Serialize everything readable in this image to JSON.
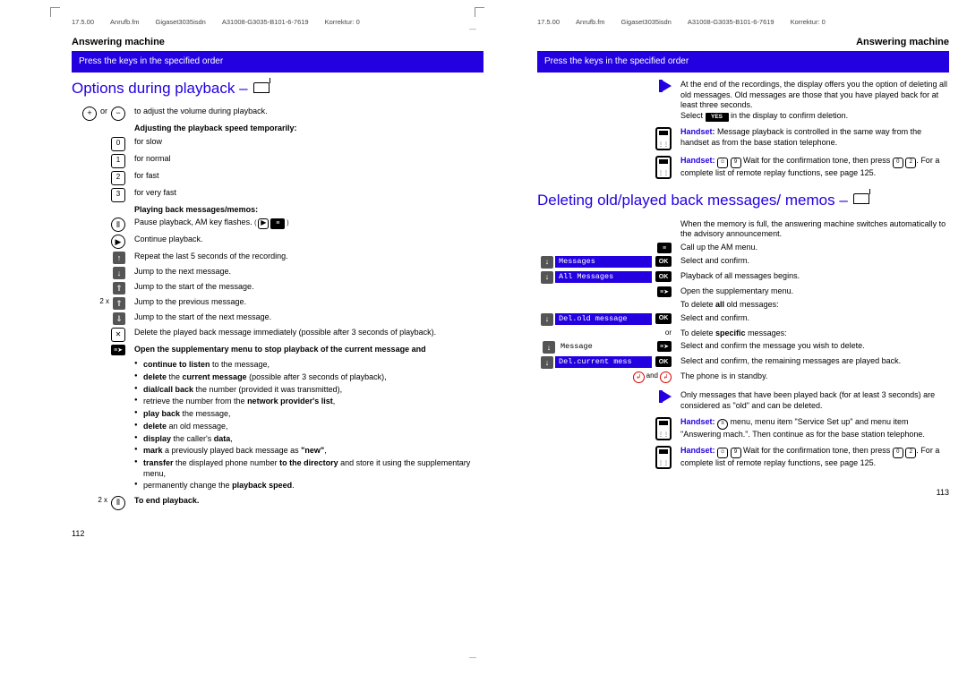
{
  "header": {
    "date": "17.5.00",
    "file": "Anrufb.fm",
    "model": "Gigaset3035isdn",
    "doc": "A31008-G3035-B101-6-7619",
    "korr": "Korrektur: 0"
  },
  "left": {
    "section": "Answering machine",
    "bar": "Press the keys in the specified order",
    "heading": "Options during playback –",
    "r1": "to adjust the volume during playback.",
    "r2": "Adjusting the playback speed temporarily:",
    "r3": "for slow",
    "r4": "for normal",
    "r5": "for fast",
    "r6": "for very fast",
    "r7": "Playing back messages/memos:",
    "r8": "Pause playback, AM key flashes.",
    "r9": "Continue playback.",
    "r10": "Repeat the last 5 seconds of the recording.",
    "r11": "Jump to the next message.",
    "r12": "Jump to the start of the message.",
    "r13": "Jump to the previous message.",
    "r14": "Jump to the start of the next message.",
    "r15": "Delete the played back message immediately (possible after 3 seconds of playback).",
    "r16": "Open the supplementary menu to stop playback of the current message and",
    "b1a": "continue to listen",
    "b1b": " to the message,",
    "b2a": "delete ",
    "b2b": "current message",
    "b2c": " (possible after 3 seconds of playback),",
    "b3a": "dial/call back",
    "b3b": " the number (provided it was transmitted),",
    "b4a": "retrieve the number from the ",
    "b4b": "network provider's list",
    "b5a": "play back",
    "b5b": " the message,",
    "b6a": "delete",
    "b6b": " an old message,",
    "b7a": "display",
    "b7b": " the caller's ",
    "b7c": "data",
    "b8a": "mark",
    "b8b": " a previously played back message as ",
    "b8c": "\"new\"",
    "b9a": "transfer",
    "b9b": " the displayed phone number ",
    "b9c": "to the directory",
    "b9d": " and store it using the supplementary menu,",
    "b10": "permanently change the ",
    "b10b": "playback speed",
    "r17": "To end playback.",
    "prefix2x": "2 x",
    "pagenum": "112"
  },
  "right": {
    "section": "Answering machine",
    "bar": "Press the keys in the specified order",
    "note1": "At the end of the recordings, the display offers you the option of deleting all old messages. Old messages are those that you have played back for at least three seconds.",
    "note1b": "Select ",
    "note1c": " in the display to confirm deletion.",
    "note2a": "Handset: ",
    "note2b": "Message playback is controlled in the same way from the handset as from the base station telephone.",
    "note3a": "Handset: ",
    "note3b": "Wait for the confirmation tone, then press ",
    "note3c": ". For a complete list of remote replay functions, see page 125.",
    "heading": "Deleting old/played back messages/ memos –",
    "intro": "When the memory is full, the answering machine switches automatically to the advisory announcement.",
    "m1": "Call up the AM menu.",
    "m2": "Select and confirm.",
    "m3": "Playback of all messages begins.",
    "m4": "Open the supplementary menu.",
    "m5": "To delete ",
    "m5b": "all",
    "m5c": " old messages:",
    "m6": "Select and confirm.",
    "or": "or",
    "m7": "To delete ",
    "m7b": "specific",
    "m7c": " messages:",
    "m8": "Select and confirm the message you wish to delete.",
    "m9": "Select and confirm, the remaining messages are played back.",
    "and": " and ",
    "m10": "The phone is in standby.",
    "n4": "Only messages that have been played back (for at least 3 seconds) are considered as \"old\" and can be deleted.",
    "n5a": "Handset: ",
    "n5b": " menu, menu item \"Service Set up\" and menu item \"Answering mach.\". Then continue as for the base station telephone.",
    "n6a": "Handset: ",
    "n6b": "Wait for the confirmation tone, then press ",
    "n6c": ". For a complete list of remote replay functions, see page 125.",
    "menu_messages": "Messages",
    "menu_all": "All Messages",
    "menu_delold": "Del.old message",
    "menu_message": "Message",
    "menu_delcurr": "Del.current mess",
    "ok": "OK",
    "yes": "YES",
    "pagenum": "113"
  }
}
